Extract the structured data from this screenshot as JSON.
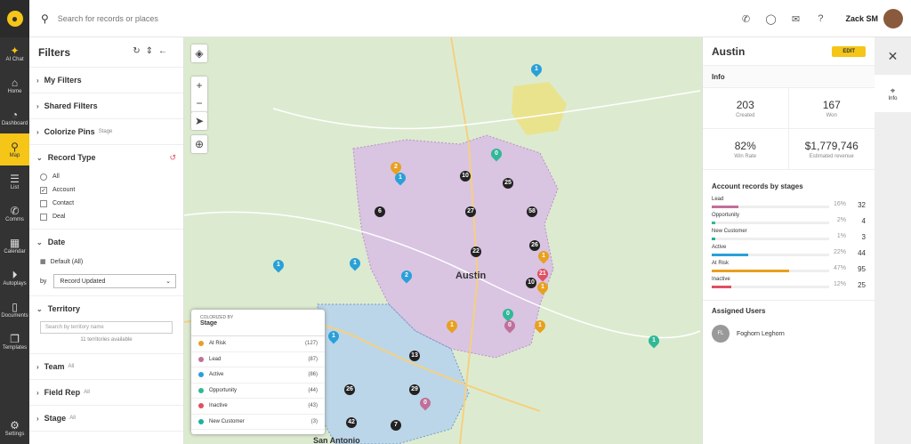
{
  "nav": {
    "items": [
      {
        "label": "AI Chat"
      },
      {
        "label": "Home"
      },
      {
        "label": "Dashboard"
      },
      {
        "label": "Map"
      },
      {
        "label": "List"
      },
      {
        "label": "Comms"
      },
      {
        "label": "Calendar"
      },
      {
        "label": "Autoplays"
      },
      {
        "label": "Documents"
      },
      {
        "label": "Templates"
      }
    ],
    "settings": "Settings"
  },
  "topbar": {
    "search_placeholder": "Search for records or places",
    "user": "Zack SM"
  },
  "filters": {
    "title": "Filters",
    "my_filters": "My Filters",
    "shared_filters": "Shared Filters",
    "colorize_pins": "Colorize Pins",
    "colorize_sub": "Stage",
    "record_type": "Record Type",
    "record_options": [
      "All",
      "Account",
      "Contact",
      "Deal"
    ],
    "date": "Date",
    "date_default": "Default (All)",
    "by_label": "by",
    "by_value": "Record Updated",
    "territory": "Territory",
    "territory_placeholder": "Search by territory name",
    "territory_count": "11 territories available",
    "team": "Team",
    "team_sub": "All",
    "field_rep": "Field Rep",
    "field_rep_sub": "All",
    "stage": "Stage",
    "stage_sub": "All"
  },
  "legend": {
    "colorized_by": "COLORIZED BY",
    "field": "Stage",
    "rows": [
      {
        "label": "At Risk",
        "count": "(127)",
        "color": "#e8a020"
      },
      {
        "label": "Lead",
        "count": "(87)",
        "color": "#c0709a"
      },
      {
        "label": "Active",
        "count": "(86)",
        "color": "#2aa0d8"
      },
      {
        "label": "Opportunity",
        "count": "(44)",
        "color": "#30b898"
      },
      {
        "label": "Inactive",
        "count": "(43)",
        "color": "#e05060"
      },
      {
        "label": "New Customer",
        "count": "(3)",
        "color": "#20b0a0"
      }
    ]
  },
  "map": {
    "labels": [
      {
        "t": "Austin"
      },
      {
        "t": "San Antonio"
      }
    ],
    "pins": [
      "2",
      "1",
      "0",
      "10",
      "25",
      "1",
      "6",
      "27",
      "58",
      "22",
      "26",
      "1",
      "21",
      "1",
      "10",
      "1",
      "1",
      "2",
      "0",
      "1",
      "0",
      "13",
      "1",
      "29",
      "26",
      "0",
      "7",
      "42",
      "1",
      "1"
    ]
  },
  "right": {
    "title": "Austin",
    "edit": "EDIT",
    "info": "Info",
    "stats": [
      {
        "v": "203",
        "l": "Created"
      },
      {
        "v": "167",
        "l": "Won"
      },
      {
        "v": "82%",
        "l": "Win Rate"
      },
      {
        "v": "$1,779,746",
        "l": "Estimated revenue"
      }
    ],
    "stages_title": "Account records by stages",
    "stages": [
      {
        "name": "Lead",
        "pct": "16%",
        "count": "32",
        "frac": 0.16,
        "color": "#c0709a"
      },
      {
        "name": "Opportunity",
        "pct": "2%",
        "count": "4",
        "frac": 0.02,
        "color": "#30b898"
      },
      {
        "name": "New Customer",
        "pct": "1%",
        "count": "3",
        "frac": 0.01,
        "color": "#20b0a0"
      },
      {
        "name": "Active",
        "pct": "22%",
        "count": "44",
        "frac": 0.22,
        "color": "#2aa0d8"
      },
      {
        "name": "At Risk",
        "pct": "47%",
        "count": "95",
        "frac": 0.47,
        "color": "#e8a020"
      },
      {
        "name": "Inactive",
        "pct": "12%",
        "count": "25",
        "frac": 0.12,
        "color": "#e05060"
      }
    ],
    "assigned_title": "Assigned Users",
    "user_initials": "FL",
    "user_name": "Foghorn Leghorn"
  },
  "side": {
    "info": "Info"
  }
}
